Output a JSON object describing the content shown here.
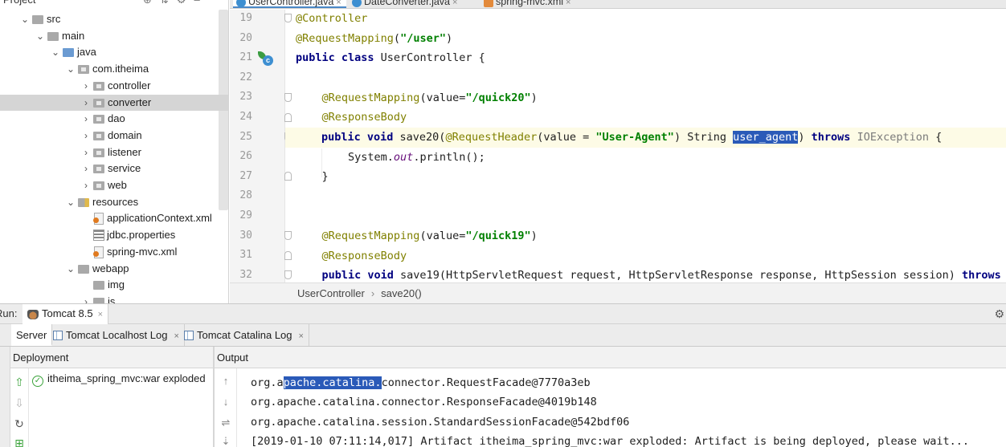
{
  "project_panel": {
    "title": "Project",
    "tree": [
      {
        "label": "src",
        "arrow": "⌄",
        "icon": "folder",
        "indent": 0
      },
      {
        "label": "main",
        "arrow": "⌄",
        "icon": "folder",
        "indent": 1
      },
      {
        "label": "java",
        "arrow": "⌄",
        "icon": "folder-blue",
        "indent": 2
      },
      {
        "label": "com.itheima",
        "arrow": "⌄",
        "icon": "package",
        "indent": 3
      },
      {
        "label": "controller",
        "arrow": "›",
        "icon": "package",
        "indent": 4
      },
      {
        "label": "converter",
        "arrow": "›",
        "icon": "package",
        "indent": 4,
        "selected": true
      },
      {
        "label": "dao",
        "arrow": "›",
        "icon": "package",
        "indent": 4
      },
      {
        "label": "domain",
        "arrow": "›",
        "icon": "package",
        "indent": 4
      },
      {
        "label": "listener",
        "arrow": "›",
        "icon": "package",
        "indent": 4
      },
      {
        "label": "service",
        "arrow": "›",
        "icon": "package",
        "indent": 4
      },
      {
        "label": "web",
        "arrow": "›",
        "icon": "package",
        "indent": 4
      },
      {
        "label": "resources",
        "arrow": "⌄",
        "icon": "folder-res",
        "indent": 3
      },
      {
        "label": "applicationContext.xml",
        "arrow": "",
        "icon": "xml",
        "indent": 4
      },
      {
        "label": "jdbc.properties",
        "arrow": "",
        "icon": "properties",
        "indent": 4
      },
      {
        "label": "spring-mvc.xml",
        "arrow": "",
        "icon": "xml",
        "indent": 4
      },
      {
        "label": "webapp",
        "arrow": "⌄",
        "icon": "folder",
        "indent": 3
      },
      {
        "label": "img",
        "arrow": "",
        "icon": "folder",
        "indent": 4
      },
      {
        "label": "js",
        "arrow": "›",
        "icon": "folder",
        "indent": 4
      }
    ]
  },
  "editor_tabs": [
    {
      "label": "UserController.java",
      "icon": "class-icon",
      "active": true
    },
    {
      "label": "DateConverter.java",
      "icon": "class-icon",
      "active": false
    },
    {
      "label": "spring-mvc.xml",
      "icon": "xml-icon",
      "active": false
    }
  ],
  "code": {
    "line_numbers": [
      "19",
      "20",
      "21",
      "22",
      "23",
      "24",
      "25",
      "26",
      "27",
      "28",
      "29",
      "30",
      "31",
      "32"
    ]
  },
  "breadcrumb": [
    "UserController",
    "save20()"
  ],
  "run_window": {
    "label": "Run:",
    "config_tab": "Tomcat 8.5",
    "sub_tabs": [
      "Server",
      "Tomcat Localhost Log",
      "Tomcat Catalina Log"
    ],
    "deployment_header": "Deployment",
    "output_header": "Output",
    "deployment_item": "itheima_spring_mvc:war exploded",
    "output_lines": [
      "org.apache.catalina.connector.RequestFacade@7770a3eb",
      "org.apache.catalina.connector.ResponseFacade@4019b148",
      "org.apache.catalina.session.StandardSessionFacade@542bdf06",
      "[2019-01-10 07:11:14,017] Artifact itheima_spring_mvc:war exploded: Artifact is being deployed, please wait..."
    ]
  },
  "colors": {
    "selection": "#2a5ab8",
    "keyword": "#000080",
    "annotation": "#808000",
    "string": "#008000",
    "current_line": "#fdfbe6"
  }
}
